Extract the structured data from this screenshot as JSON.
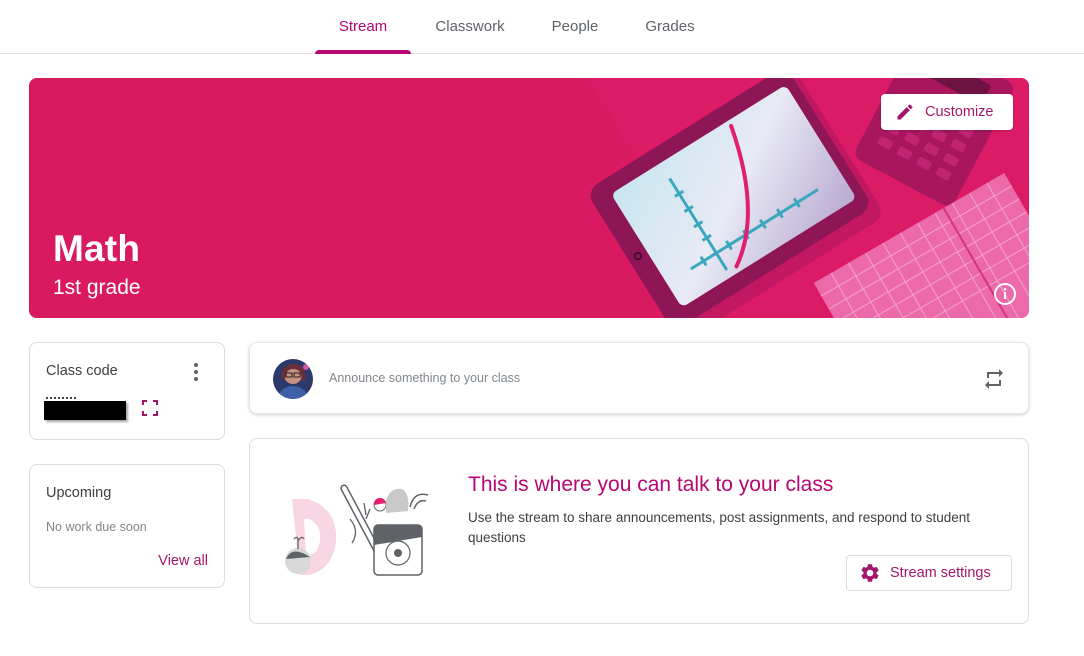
{
  "nav": {
    "tabs": [
      {
        "label": "Stream",
        "active": true
      },
      {
        "label": "Classwork",
        "active": false
      },
      {
        "label": "People",
        "active": false
      },
      {
        "label": "Grades",
        "active": false
      }
    ]
  },
  "banner": {
    "title": "Math",
    "subtitle": "1st grade",
    "customize_label": "Customize",
    "customize_icon": "pencil-icon",
    "info_icon": "info-icon",
    "color": "#d91a60"
  },
  "class_code_card": {
    "title": "Class code",
    "code": "[redacted]",
    "menu_icon": "more-vert-icon",
    "expand_icon": "fullscreen-icon"
  },
  "upcoming_card": {
    "title": "Upcoming",
    "empty_text": "No work due soon",
    "view_all_label": "View all"
  },
  "announce": {
    "placeholder": "Announce something to your class",
    "repost_icon": "repost-icon"
  },
  "empty_state": {
    "title": "This is where you can talk to your class",
    "description": "Use the stream to share announcements, post assignments, and respond to student questions",
    "settings_label": "Stream settings",
    "settings_icon": "gear-icon"
  },
  "colors": {
    "accent": "#b80672",
    "accent_text": "#a3166b",
    "banner": "#d91a60"
  }
}
